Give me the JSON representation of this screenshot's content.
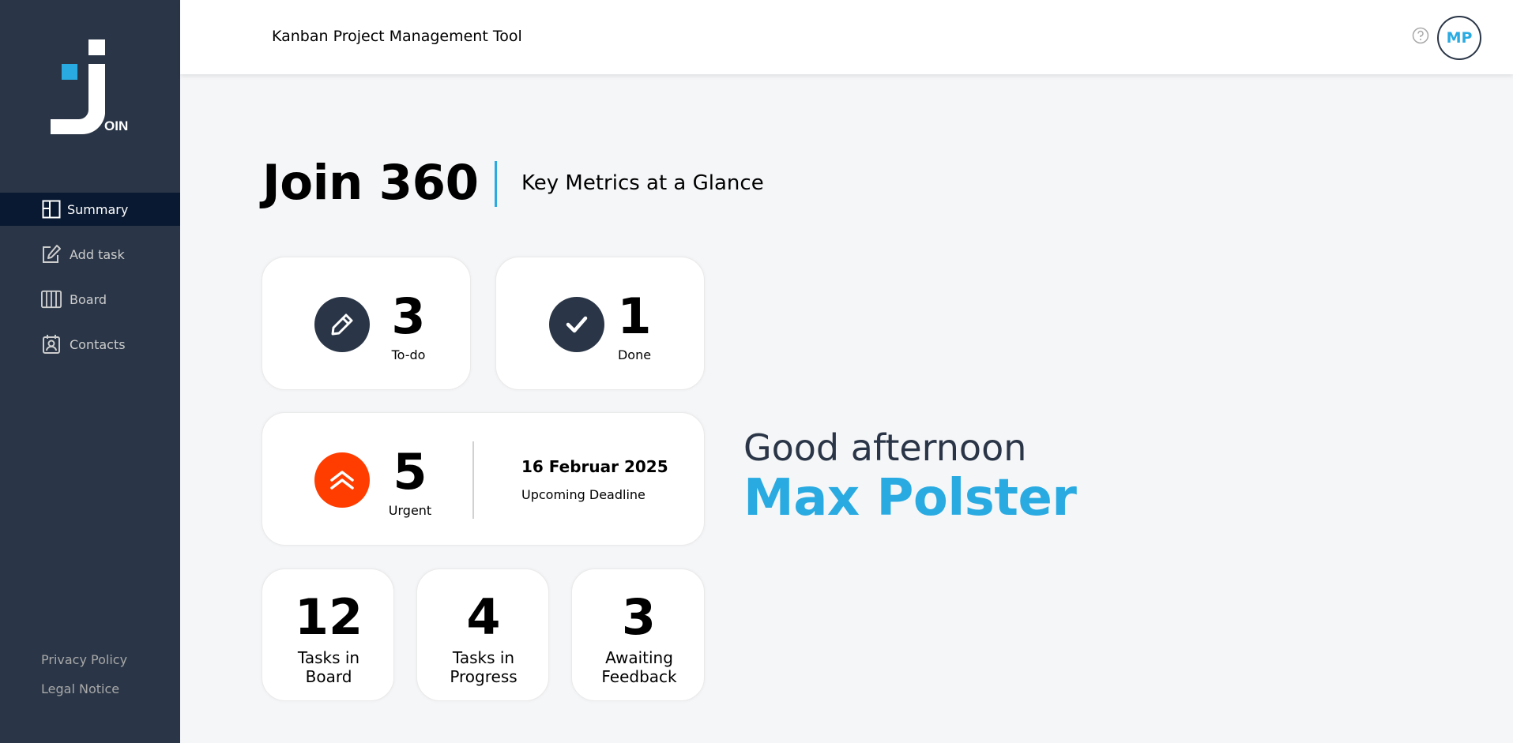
{
  "app": {
    "logo_text": "OIN",
    "header_title": "Kanban Project Management Tool",
    "user_initials": "MP"
  },
  "nav": {
    "items": [
      {
        "label": "Summary",
        "icon": "summary-icon",
        "active": true
      },
      {
        "label": "Add task",
        "icon": "add-task-icon",
        "active": false
      },
      {
        "label": "Board",
        "icon": "board-icon",
        "active": false
      },
      {
        "label": "Contacts",
        "icon": "contacts-icon",
        "active": false
      }
    ]
  },
  "legal": {
    "privacy": "Privacy Policy",
    "notice": "Legal Notice"
  },
  "page": {
    "title": "Join 360",
    "subtitle": "Key Metrics at a Glance"
  },
  "metrics": {
    "todo": {
      "value": "3",
      "label": "To-do"
    },
    "done": {
      "value": "1",
      "label": "Done"
    },
    "urgent": {
      "value": "5",
      "label": "Urgent"
    },
    "deadline": {
      "date": "16 Februar 2025",
      "label": "Upcoming Deadline"
    },
    "board": {
      "value": "12",
      "label": "Tasks in Board"
    },
    "progress": {
      "value": "4",
      "label": "Tasks in Progress"
    },
    "feedback": {
      "value": "3",
      "label": "Awaiting Feedback"
    }
  },
  "greeting": {
    "text": "Good afternoon",
    "name": "Max Polster"
  },
  "colors": {
    "sidebar": "#2A3647",
    "active_nav": "#091931",
    "accent": "#29ABE2",
    "urgent": "#FF3D00"
  }
}
